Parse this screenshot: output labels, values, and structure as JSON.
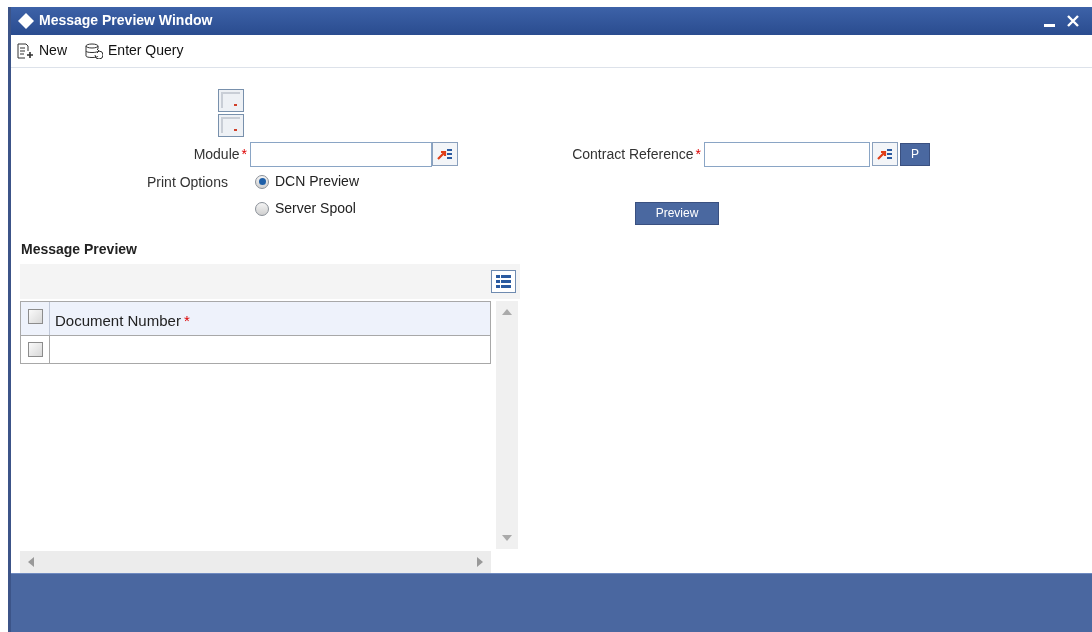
{
  "window": {
    "title": "Message Preview Window"
  },
  "toolbar": [
    {
      "label": "New",
      "kind": "new"
    },
    {
      "label": "Enter Query",
      "kind": "query"
    }
  ],
  "fields": {
    "module": {
      "label": "Module",
      "required_mark": "*"
    },
    "contract_reference": {
      "label": "Contract Reference",
      "required_mark": "*",
      "p_button": "P"
    }
  },
  "print_options": {
    "label": "Print Options",
    "options": [
      {
        "label": "DCN Preview",
        "selected": true
      },
      {
        "label": "Server Spool",
        "selected": false
      }
    ]
  },
  "preview_button": "Preview",
  "message_preview": {
    "title": "Message Preview",
    "columns": [
      {
        "label": "Document Number",
        "required_mark": "*",
        "checked": false
      }
    ],
    "rows": [
      {
        "checked": false
      }
    ]
  }
}
